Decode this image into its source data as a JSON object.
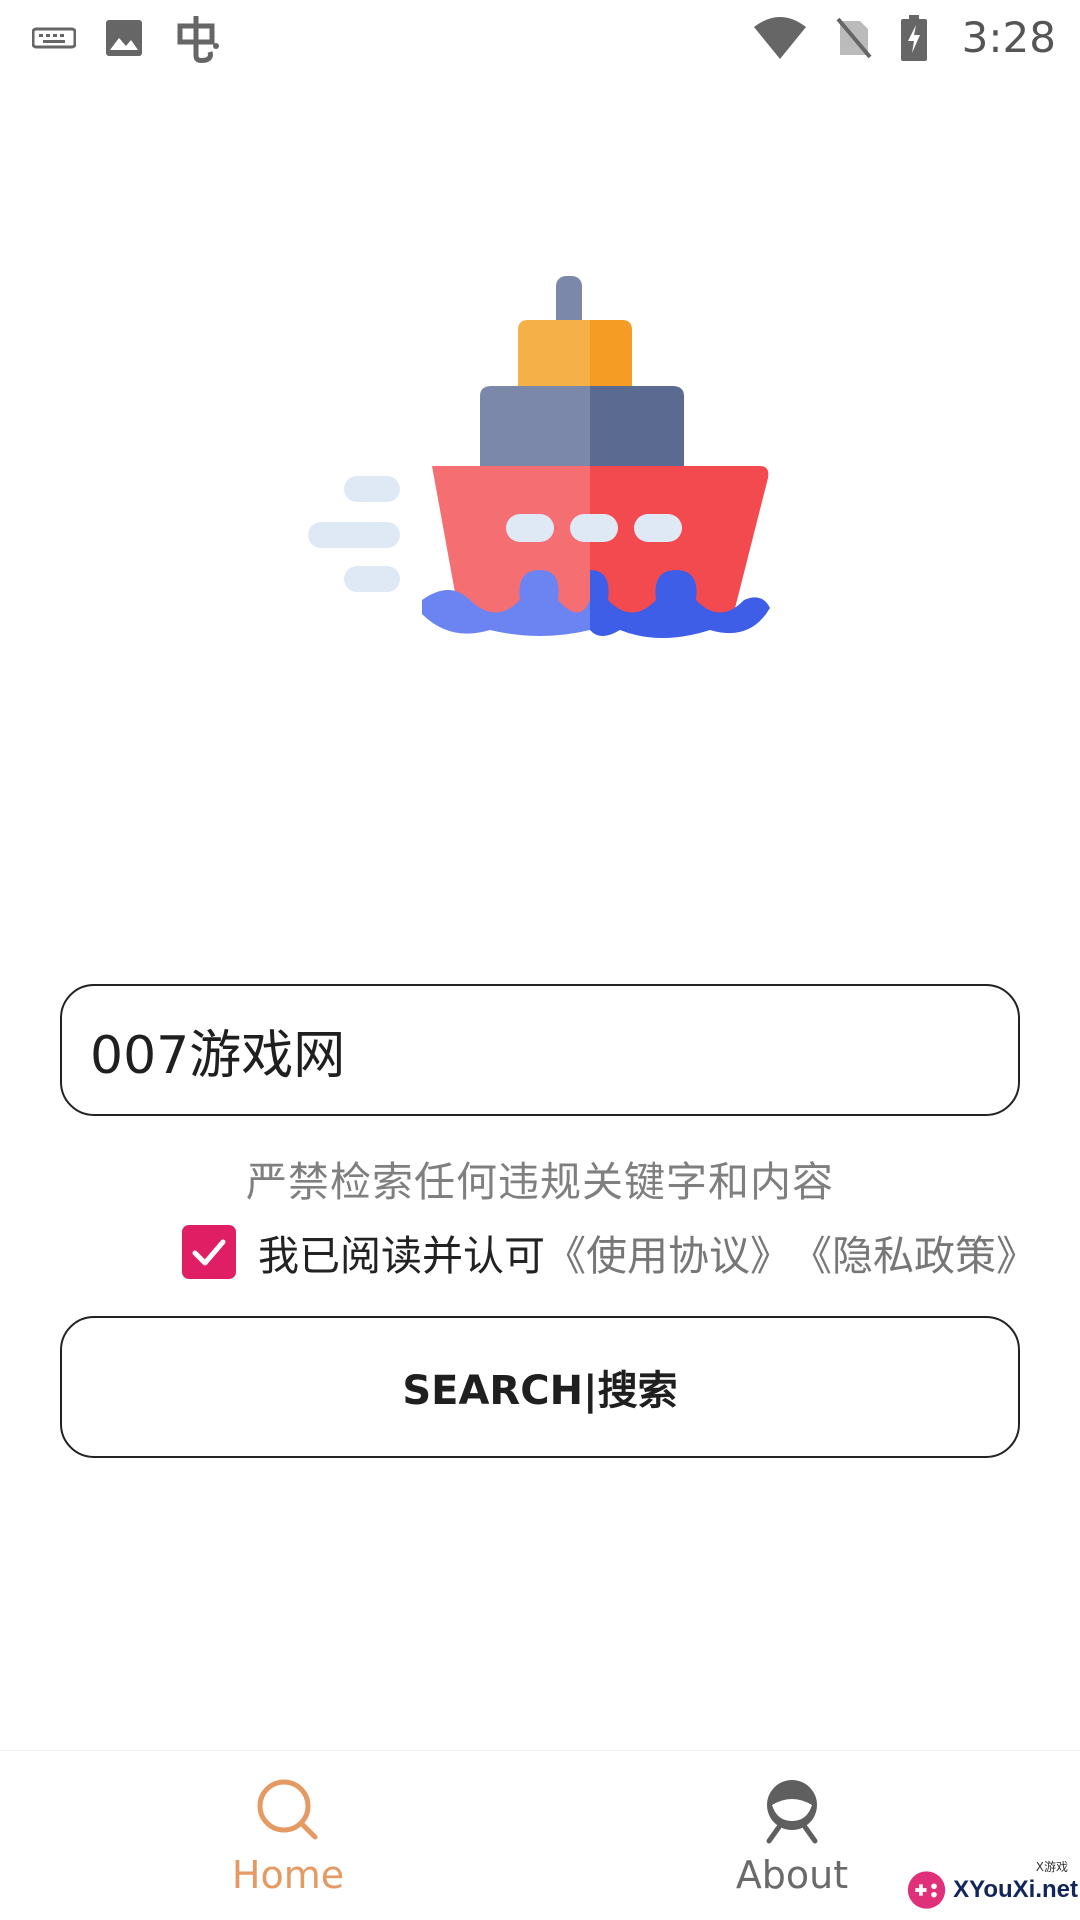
{
  "status_bar": {
    "time": "3:28",
    "icons": [
      "keyboard-icon",
      "image-icon",
      "bug-icon",
      "wifi-icon",
      "no-sim-icon",
      "battery-charging-icon"
    ]
  },
  "search": {
    "value": "007游戏网"
  },
  "notice": "严禁检索任何违规关键字和内容",
  "agreement": {
    "checked": true,
    "text": "我已阅读并认可",
    "terms_link": "《使用协议》",
    "privacy_link": "《隐私政策》"
  },
  "search_button": {
    "label": "SEARCH|搜索"
  },
  "bottom_nav": {
    "home_label": "Home",
    "about_label": "About",
    "active": "home"
  },
  "watermark": {
    "text": "XYouXi.net",
    "small": "X游戏"
  },
  "colors": {
    "accent": "#e01e64",
    "nav_active": "#e69a63"
  }
}
